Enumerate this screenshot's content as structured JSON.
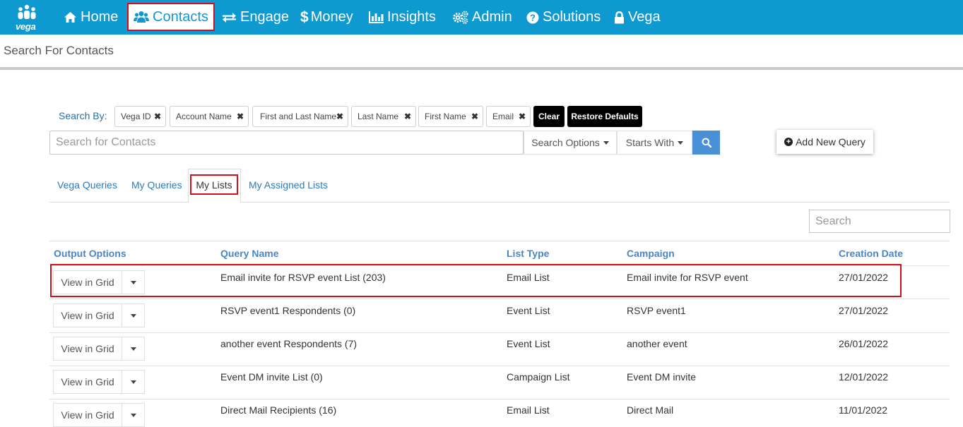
{
  "nav": {
    "logo_text": "vega",
    "items": [
      {
        "label": "Home",
        "icon": "home-icon"
      },
      {
        "label": "Contacts",
        "icon": "users-icon"
      },
      {
        "label": "Engage",
        "icon": "exchange-icon"
      },
      {
        "label": "Money",
        "icon": "dollar-icon"
      },
      {
        "label": "Insights",
        "icon": "bar-chart-icon"
      },
      {
        "label": "Admin",
        "icon": "gears-icon"
      },
      {
        "label": "Solutions",
        "icon": "question-circle-icon"
      },
      {
        "label": "Vega",
        "icon": "lock-icon"
      }
    ]
  },
  "page": {
    "title": "Search For Contacts"
  },
  "search_by": {
    "label": "Search By:",
    "chips": [
      "Vega ID",
      "Account Name",
      "First and Last Name",
      "Last Name",
      "First Name",
      "Email"
    ],
    "clear_label": "Clear",
    "restore_label": "Restore Defaults"
  },
  "search": {
    "placeholder": "Search for Contacts",
    "options_label": "Search Options",
    "match_label": "Starts With",
    "add_query_label": "Add New Query"
  },
  "tabs": {
    "items": [
      "Vega Queries",
      "My Queries",
      "My Lists",
      "My Assigned Lists"
    ],
    "active": "My Lists"
  },
  "table": {
    "search_placeholder": "Search",
    "columns": [
      "Output Options",
      "Query Name",
      "List Type",
      "Campaign",
      "Creation Date"
    ],
    "view_label": "View in Grid",
    "rows": [
      {
        "name": "Email invite for RSVP event List (203)",
        "type": "Email List",
        "campaign": "Email invite for RSVP event",
        "date": "27/01/2022"
      },
      {
        "name": "RSVP event1 Respondents (0)",
        "type": "Event List",
        "campaign": "RSVP event1",
        "date": "27/01/2022"
      },
      {
        "name": "another event Respondents (7)",
        "type": "Event List",
        "campaign": "another event",
        "date": "26/01/2022"
      },
      {
        "name": "Event DM invite List (0)",
        "type": "Campaign List",
        "campaign": "Event DM invite",
        "date": "12/01/2022"
      },
      {
        "name": "Direct Mail Recipients (16)",
        "type": "Email List",
        "campaign": "Direct Mail",
        "date": "11/01/2022"
      }
    ]
  },
  "colors": {
    "nav_bg": "#0e9ad1",
    "highlight": "#d0111b",
    "link": "#2a7bbf",
    "search_button": "#4a90d6"
  }
}
